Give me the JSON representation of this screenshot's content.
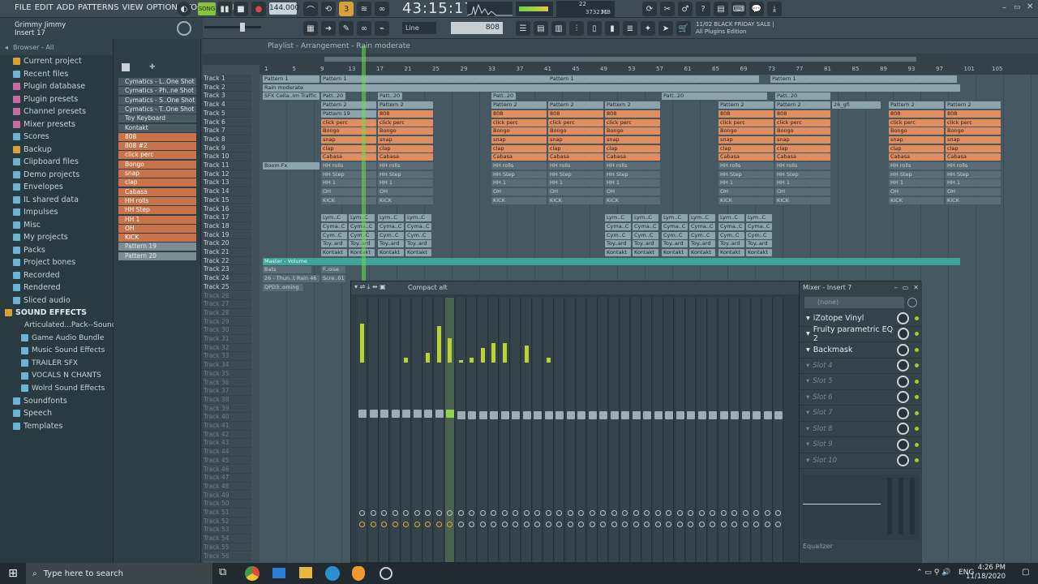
{
  "menu": [
    "FILE",
    "EDIT",
    "ADD",
    "PATTERNS",
    "VIEW",
    "OPTIONS",
    "TOOLS",
    "HELP"
  ],
  "transport": {
    "song_label": "SONG",
    "tempo": "144.000",
    "time": "43:15:17",
    "pat_label": "PAT",
    "mem": "3732 MB",
    "cpu": "22",
    "poly": "11"
  },
  "hint": {
    "project": "Grimmy Jimmy",
    "insert": "Insert 17"
  },
  "promo": {
    "date": "11/02",
    "title": "BLACK FRIDAY SALE |",
    "subtitle": "All Plugins Edition"
  },
  "toolbar2": {
    "snap": "Line",
    "value": "808"
  },
  "browser": {
    "header": "Browser - All",
    "items": [
      {
        "label": "Current project",
        "kind": "item",
        "color": "#d9a03a"
      },
      {
        "label": "Recent files",
        "kind": "item",
        "color": "#6cb3d8"
      },
      {
        "label": "Plugin database",
        "kind": "item",
        "color": "#c96aa1"
      },
      {
        "label": "Plugin presets",
        "kind": "item",
        "color": "#c96aa1"
      },
      {
        "label": "Channel presets",
        "kind": "item",
        "color": "#c96aa1"
      },
      {
        "label": "Mixer presets",
        "kind": "item",
        "color": "#c96aa1"
      },
      {
        "label": "Scores",
        "kind": "item",
        "color": "#6cb3d8"
      },
      {
        "label": "Backup",
        "kind": "item",
        "color": "#d9a03a"
      },
      {
        "label": "Clipboard files",
        "kind": "item",
        "color": "#6cb3d8"
      },
      {
        "label": "Demo projects",
        "kind": "item",
        "color": "#6cb3d8"
      },
      {
        "label": "Envelopes",
        "kind": "item",
        "color": "#6cb3d8"
      },
      {
        "label": "IL shared data",
        "kind": "item",
        "color": "#6cb3d8"
      },
      {
        "label": "Impulses",
        "kind": "item",
        "color": "#6cb3d8"
      },
      {
        "label": "Misc",
        "kind": "item",
        "color": "#6cb3d8"
      },
      {
        "label": "My projects",
        "kind": "item",
        "color": "#6cb3d8"
      },
      {
        "label": "Packs",
        "kind": "item",
        "color": "#6cb3d8"
      },
      {
        "label": "Project bones",
        "kind": "item",
        "color": "#6cb3d8"
      },
      {
        "label": "Recorded",
        "kind": "item",
        "color": "#6cb3d8"
      },
      {
        "label": "Rendered",
        "kind": "item",
        "color": "#6cb3d8"
      },
      {
        "label": "Sliced audio",
        "kind": "item",
        "color": "#6cb3d8"
      },
      {
        "label": "SOUND EFFECTS",
        "kind": "sec",
        "color": "#d9a03a"
      },
      {
        "label": "Articulated...Pack--Sounds",
        "kind": "sub",
        "color": "#6cb3d8"
      },
      {
        "label": "Game Audio Bundle",
        "kind": "sub",
        "color": "#6cb3d8"
      },
      {
        "label": "Music Sound Effects",
        "kind": "sub",
        "color": "#6cb3d8"
      },
      {
        "label": "TRAILER SFX",
        "kind": "sub",
        "color": "#6cb3d8"
      },
      {
        "label": "VOCALS N CHANTS",
        "kind": "sub",
        "color": "#6cb3d8"
      },
      {
        "label": "Wolrd Sound Effects",
        "kind": "sub",
        "color": "#6cb3d8"
      },
      {
        "label": "Soundfonts",
        "kind": "item",
        "color": "#6cb3d8"
      },
      {
        "label": "Speech",
        "kind": "item",
        "color": "#6cb3d8"
      },
      {
        "label": "Templates",
        "kind": "item",
        "color": "#6cb3d8"
      }
    ]
  },
  "channels": [
    {
      "label": "Cymatics - L..One Shot - C",
      "c": "g"
    },
    {
      "label": "Cymatics - Ph..ne Shot - C",
      "c": "g"
    },
    {
      "label": "Cymatics - S..One Shot - C",
      "c": "g"
    },
    {
      "label": "Cymatics - T..One Shot - C",
      "c": "g"
    },
    {
      "label": "Toy Keyboard",
      "c": "g"
    },
    {
      "label": "Kontakt",
      "c": "g"
    },
    {
      "label": "808",
      "c": "o"
    },
    {
      "label": "808 #2",
      "c": "o"
    },
    {
      "label": "click perc",
      "c": "o"
    },
    {
      "label": "Bongo",
      "c": "o"
    },
    {
      "label": "snap",
      "c": "o"
    },
    {
      "label": "clap",
      "c": "o"
    },
    {
      "label": "Cabasa",
      "c": "o"
    },
    {
      "label": "HH rolls",
      "c": "o"
    },
    {
      "label": "HH Step",
      "c": "o"
    },
    {
      "label": "HH 1",
      "c": "o"
    },
    {
      "label": "OH",
      "c": "o"
    },
    {
      "label": "KICK",
      "c": "o"
    },
    {
      "label": "Pattern 19",
      "c": "l"
    },
    {
      "label": "Pattern 20",
      "c": "l"
    }
  ],
  "playlist": {
    "title": "Playlist - Arrangement - Rain moderate",
    "ruler": [
      "1",
      "5",
      "9",
      "13",
      "17",
      "21",
      "25",
      "29",
      "33",
      "37",
      "41",
      "45",
      "49",
      "53",
      "57",
      "61",
      "65",
      "69",
      "73",
      "77",
      "81",
      "85",
      "89",
      "93",
      "97",
      "101",
      "105"
    ],
    "tracks": [
      "Track 1",
      "Track 2",
      "Track 3",
      "Track 4",
      "Track 5",
      "Track 6",
      "Track 7",
      "Track 8",
      "Track 9",
      "Track 10",
      "Track 11",
      "Track 12",
      "Track 13",
      "Track 14",
      "Track 15",
      "Track 16",
      "Track 17",
      "Track 18",
      "Track 19",
      "Track 20",
      "Track 21",
      "Track 22",
      "Track 23",
      "Track 24",
      "Track 25",
      "Track 26",
      "Track 27",
      "Track 28",
      "Track 29",
      "Track 30",
      "Track 31",
      "Track 32",
      "Track 33",
      "Track 34",
      "Track 35",
      "Track 36",
      "Track 37",
      "Track 38",
      "Track 39",
      "Track 40",
      "Track 41",
      "Track 42",
      "Track 43",
      "Track 44",
      "Track 45",
      "Track 46",
      "Track 47",
      "Track 48",
      "Track 49",
      "Track 50",
      "Track 51",
      "Track 52",
      "Track 53",
      "Track 54",
      "Track 55",
      "Track 56"
    ],
    "clip_labels": {
      "t1": "Pattern 1",
      "t2": "Rain moderate",
      "t3": "SFX Cella..Im Traffic",
      "t3b": "Patt..20",
      "t4": "Pattern 2",
      "t4b": "26_gfi",
      "t5": "Pattern 19",
      "t5b": "808",
      "t6": "click perc",
      "t7": "Bongo",
      "t8": "snap",
      "t9": "clap",
      "t10": "Cabasa",
      "t11": "Boom Fx",
      "t11b": "HH rolls",
      "t12": "HH Step",
      "t13": "HH 1",
      "t14": "OH",
      "t15": "KICK",
      "t17": "Lym..C",
      "t18": "Cyma..C",
      "t19": "Cym..C",
      "t20": "Toy..ard",
      "t21": "Kontakt",
      "t22": "Master - Volume",
      "t23": "Bats",
      "t23b": "F..oise",
      "t24": "26 - Thun..t Rain 46",
      "t24b": "Scre..01",
      "t25": "QPD3..oming"
    }
  },
  "mixer": {
    "title": "Compact alt",
    "window": "Mixer - Insert 7",
    "preset": "(none)",
    "slots": [
      {
        "label": "iZotope Vinyl",
        "filled": true
      },
      {
        "label": "Fruity parametric EQ 2",
        "filled": true
      },
      {
        "label": "Backmask",
        "filled": true
      },
      {
        "label": "Slot 4",
        "filled": false
      },
      {
        "label": "Slot 5",
        "filled": false
      },
      {
        "label": "Slot 6",
        "filled": false
      },
      {
        "label": "Slot 7",
        "filled": false
      },
      {
        "label": "Slot 8",
        "filled": false
      },
      {
        "label": "Slot 9",
        "filled": false
      },
      {
        "label": "Slot 10",
        "filled": false
      }
    ],
    "eq_label": "Equalizer",
    "meters": [
      0.8,
      0,
      0,
      0,
      0.1,
      0,
      0.2,
      0.75,
      0.5,
      0.05,
      0.1,
      0.3,
      0.4,
      0.4,
      0,
      0.35,
      0,
      0.1,
      0,
      0,
      0,
      0,
      0,
      0,
      0,
      0,
      0,
      0,
      0,
      0,
      0,
      0,
      0,
      0,
      0,
      0,
      0,
      0,
      0
    ]
  },
  "taskbar": {
    "search": "Type here to search",
    "lang": "ENG",
    "time": "4:26 PM",
    "date": "11/18/2020"
  }
}
